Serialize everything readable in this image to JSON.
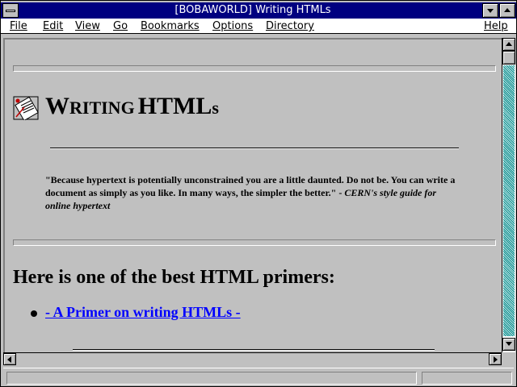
{
  "window": {
    "title": "[BOBAWORLD] Writing HTMLs"
  },
  "menu": {
    "items": [
      {
        "label": "File"
      },
      {
        "label": "Edit"
      },
      {
        "label": "View"
      },
      {
        "label": "Go"
      },
      {
        "label": "Bookmarks"
      },
      {
        "label": "Options"
      },
      {
        "label": "Directory"
      },
      {
        "label": "Help"
      }
    ]
  },
  "page": {
    "title_first_big": "W",
    "title_first_small": "RITING",
    "title_second_big": "HTML",
    "title_second_small": "s",
    "quote_text": "\"Because hypertext is potentially unconstrained you are a little daunted. Do not be. You can write a document as simply as you like. In many ways, the simpler the better.\" - ",
    "quote_cite": "CERN's style guide for online hypertext",
    "heading": "Here is one of the best HTML primers:",
    "link_label": "- A Primer on writing HTMLs -"
  },
  "status": {
    "text": ""
  },
  "icons": {
    "document": "document-icon",
    "system_menu": "system-menu-icon"
  }
}
